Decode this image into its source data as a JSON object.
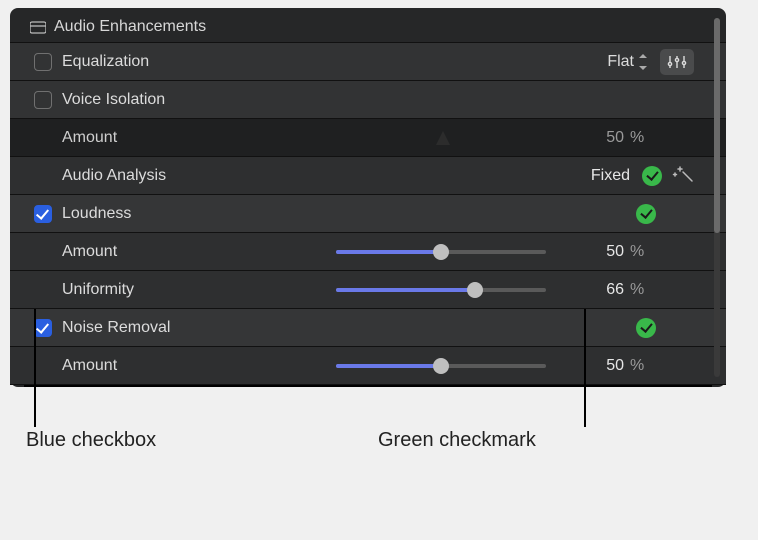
{
  "section_title": "Audio Enhancements",
  "equalization": {
    "label": "Equalization",
    "preset": "Flat",
    "checked": false
  },
  "voice_isolation": {
    "label": "Voice Isolation",
    "checked": false,
    "amount": {
      "label": "Amount",
      "value": "50",
      "unit": "%"
    },
    "analysis": {
      "label": "Audio Analysis",
      "status": "Fixed"
    }
  },
  "loudness": {
    "label": "Loudness",
    "checked": true,
    "amount": {
      "label": "Amount",
      "value": "50",
      "unit": "%",
      "percent": 50
    },
    "uniformity": {
      "label": "Uniformity",
      "value": "66",
      "unit": "%",
      "percent": 66
    }
  },
  "noise_removal": {
    "label": "Noise Removal",
    "checked": true,
    "amount": {
      "label": "Amount",
      "value": "50",
      "unit": "%",
      "percent": 50
    }
  },
  "callouts": {
    "blue_checkbox": "Blue checkbox",
    "green_checkmark": "Green checkmark"
  }
}
